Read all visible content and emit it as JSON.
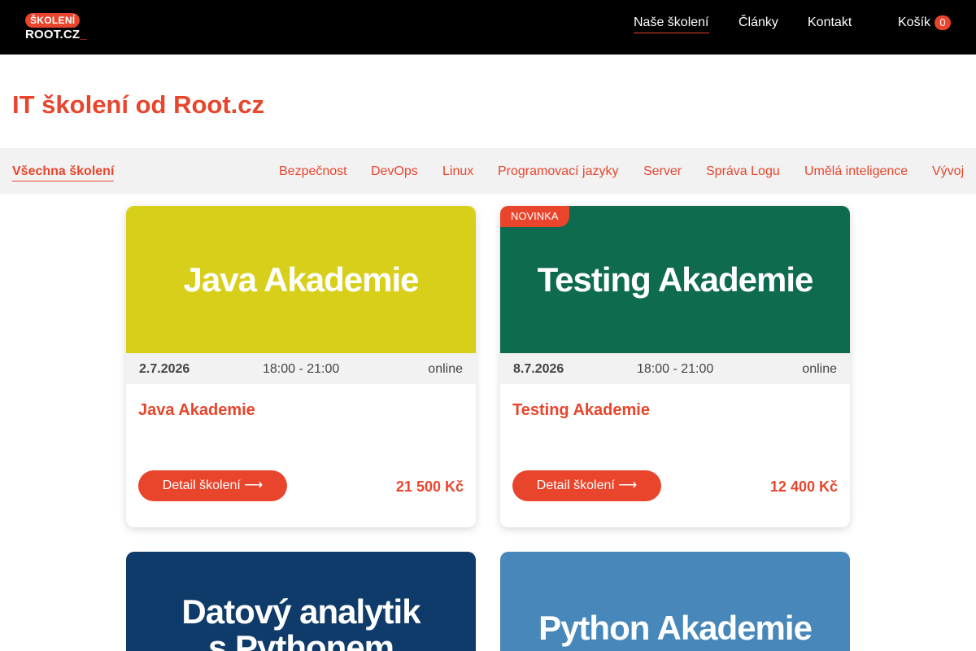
{
  "header": {
    "logo_badge": "ŠKOLENÍ",
    "logo_text": "ROOT.CZ",
    "logo_underscore": "_",
    "nav": [
      {
        "label": "Naše školení"
      },
      {
        "label": "Články"
      },
      {
        "label": "Kontakt"
      }
    ],
    "cart_icon": "",
    "cart_label": "Košík",
    "cart_count": "0"
  },
  "page_title": "IT školení od Root.cz",
  "categories": [
    {
      "label": "Všechna školení"
    },
    {
      "label": "Bezpečnost"
    },
    {
      "label": "DevOps"
    },
    {
      "label": "Linux"
    },
    {
      "label": "Programovací jazyky"
    },
    {
      "label": "Server"
    },
    {
      "label": "Správa Logu"
    },
    {
      "label": "Umělá inteligence"
    },
    {
      "label": "Vývoj"
    }
  ],
  "cards": [
    {
      "image_text": "Java Akademie",
      "image_color": "#d8cf1a",
      "date": "2.7.2026",
      "time": "18:00 - 21:00",
      "mode": "online",
      "title": "Java Akademie",
      "button": "Detail školení ⟶",
      "price": "21 500 Kč"
    },
    {
      "badge": "NOVINKA",
      "image_text": "Testing Akademie",
      "image_color": "#0e6b50",
      "date": "8.7.2026",
      "dot": "",
      "time": "18:00 - 21:00",
      "mode": "online",
      "title": "Testing Akademie",
      "button": "Detail školení ⟶",
      "price": "12 400 Kč"
    },
    {
      "image_text": "Datový analytik s Pythonem",
      "image_color": "#0e3b6a"
    },
    {
      "image_text": "Python Akademie",
      "image_color": "#4787b9"
    }
  ],
  "colors": {
    "accent": "#e8452c",
    "header_bg": "#000000",
    "category_bg": "#f2f2f2"
  }
}
